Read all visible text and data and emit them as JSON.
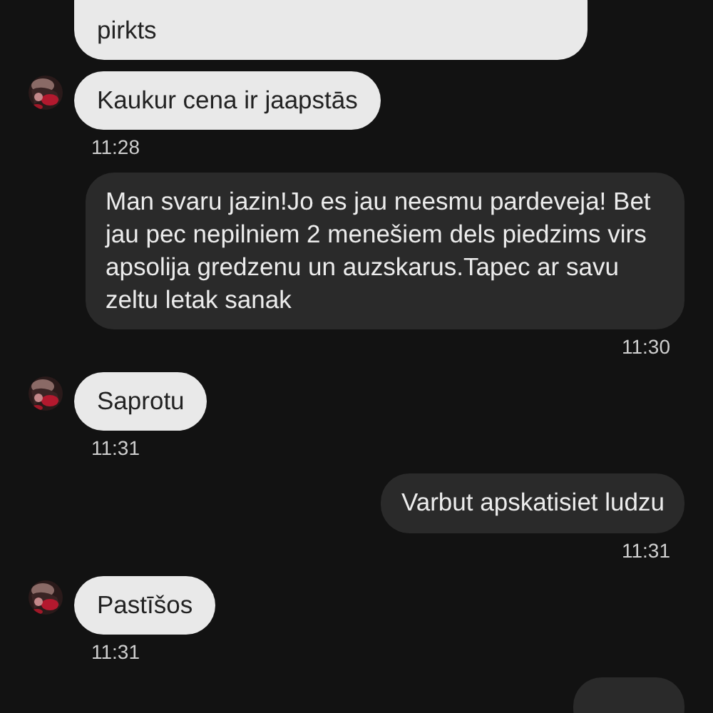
{
  "messages": [
    {
      "kind": "incoming",
      "text": "pirkts",
      "avatar": false
    },
    {
      "kind": "incoming",
      "text": "Kaukur cena ir jaapstās",
      "avatar": true,
      "time": "11:28"
    },
    {
      "kind": "outgoing",
      "text": "Man svaru jazin!Jo es jau neesmu pardeveja! Bet jau pec nepilniem 2 menešiem dels piedzims virs apsolija gredzenu un auzskarus.Tapec ar savu zeltu letak sanak",
      "time": "11:30"
    },
    {
      "kind": "incoming",
      "text": "Saprotu",
      "avatar": true,
      "time": "11:31"
    },
    {
      "kind": "outgoing",
      "text": "Varbut apskatisiet ludzu",
      "time": "11:31"
    },
    {
      "kind": "incoming",
      "text": "Pastīšos",
      "avatar": true,
      "time": "11:31"
    },
    {
      "kind": "outgoing"
    }
  ]
}
